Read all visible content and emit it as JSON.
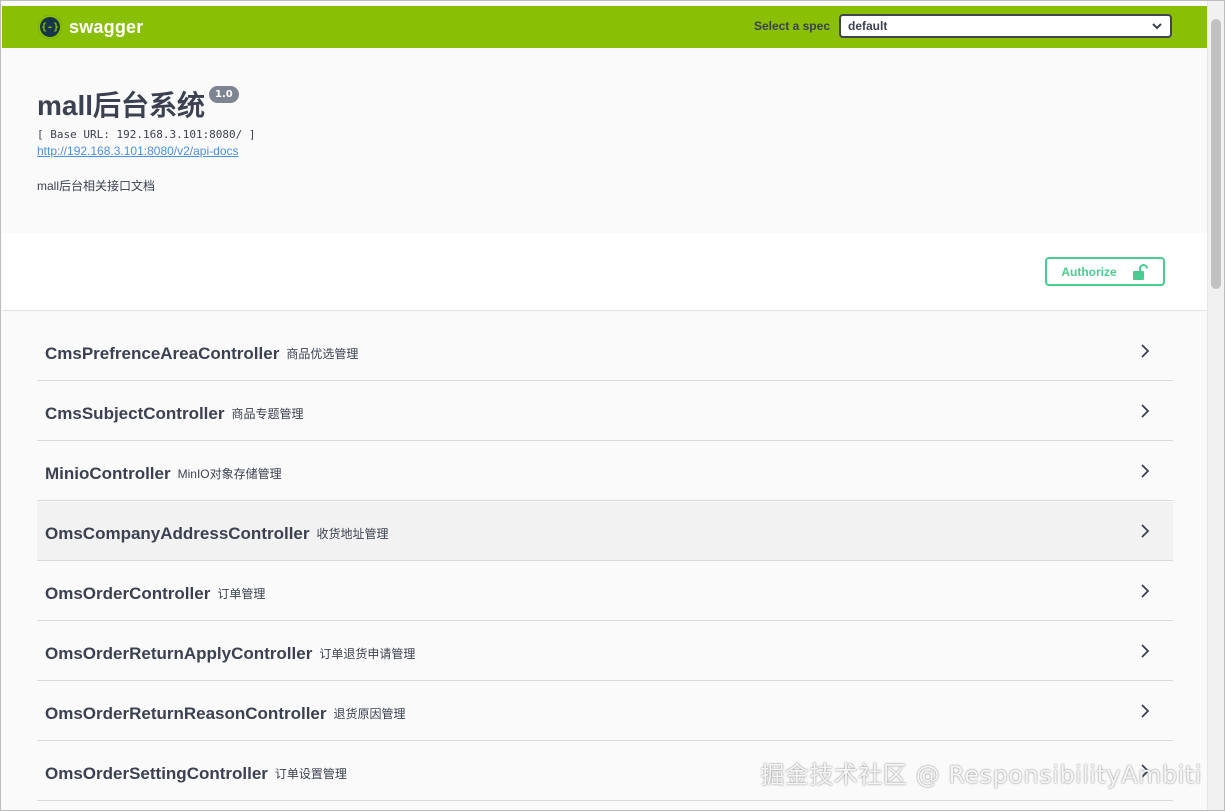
{
  "topbar": {
    "brand_logo": "{-}",
    "brand": "swagger",
    "spec_label": "Select a spec",
    "spec_value": "default",
    "color": "#89bf04"
  },
  "info": {
    "title": "mall后台系统",
    "version": "1.0",
    "base_url": "[ Base URL: 192.168.3.101:8080/ ]",
    "docs_link": "http://192.168.3.101:8080/v2/api-docs",
    "description": "mall后台相关接口文档"
  },
  "authorize": {
    "label": "Authorize",
    "color": "#49cc90"
  },
  "tags": [
    {
      "name": "CmsPrefrenceAreaController",
      "desc": "商品优选管理"
    },
    {
      "name": "CmsSubjectController",
      "desc": "商品专题管理"
    },
    {
      "name": "MinioController",
      "desc": "MinIO对象存储管理"
    },
    {
      "name": "OmsCompanyAddressController",
      "desc": "收货地址管理"
    },
    {
      "name": "OmsOrderController",
      "desc": "订单管理"
    },
    {
      "name": "OmsOrderReturnApplyController",
      "desc": "订单退货申请管理"
    },
    {
      "name": "OmsOrderReturnReasonController",
      "desc": "退货原因管理"
    },
    {
      "name": "OmsOrderSettingController",
      "desc": "订单设置管理"
    }
  ],
  "watermark": "掘金技术社区 @ ResponsibilityAmbiti"
}
